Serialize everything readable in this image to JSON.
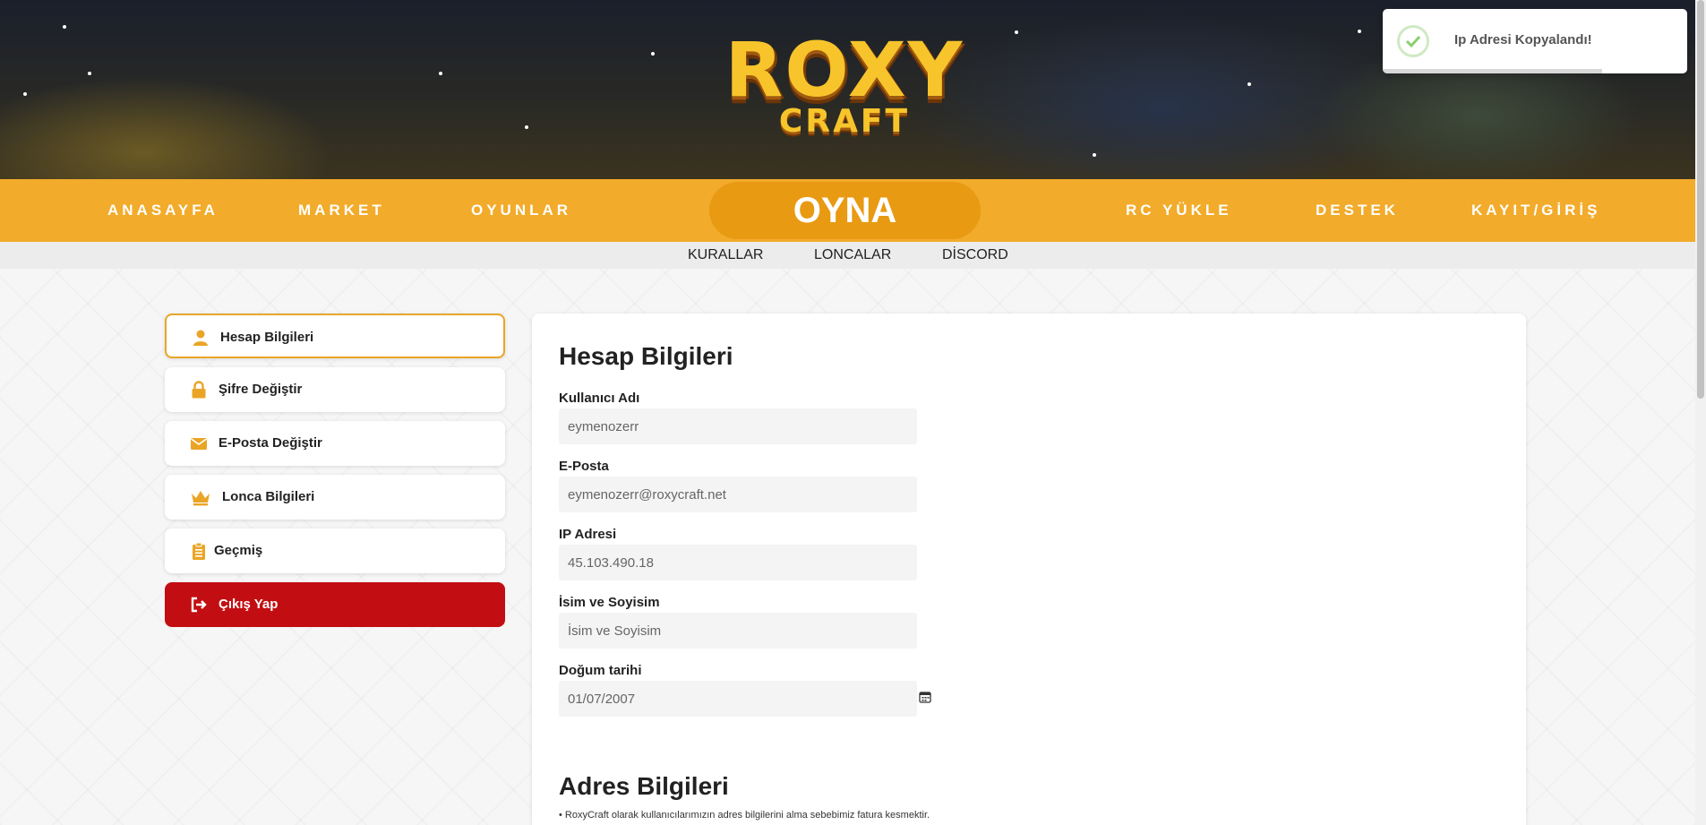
{
  "logo": {
    "line1": "ROXY",
    "line2": "CRAFT"
  },
  "nav": {
    "left": [
      "ANASAYFA",
      "MARKET",
      "OYUNLAR"
    ],
    "play": "OYNA",
    "right": [
      "RC YÜKLE",
      "DESTEK",
      "KAYIT/GİRİŞ"
    ]
  },
  "subnav": [
    "KURALLAR",
    "LONCALAR",
    "DİSCORD"
  ],
  "sidebar": {
    "items": [
      {
        "label": "Hesap Bilgileri",
        "icon": "user-icon"
      },
      {
        "label": "Şifre Değiştir",
        "icon": "lock-icon"
      },
      {
        "label": "E-Posta Değiştir",
        "icon": "envelope-icon"
      },
      {
        "label": "Lonca Bilgileri",
        "icon": "crown-icon"
      },
      {
        "label": "Geçmiş",
        "icon": "clipboard-icon"
      },
      {
        "label": "Çıkış Yap",
        "icon": "sign-out-icon"
      }
    ]
  },
  "account": {
    "title": "Hesap Bilgileri",
    "username_label": "Kullanıcı Adı",
    "username_value": "eymenozerr",
    "email_label": "E-Posta",
    "email_value": "eymenozerr@roxycraft.net",
    "ip_label": "IP Adresi",
    "ip_value": "45.103.490.18",
    "name_label": "İsim ve Soyisim",
    "name_placeholder": "İsim ve Soyisim",
    "birth_label": "Doğum tarihi",
    "birth_value": "01/07/2007"
  },
  "address": {
    "title": "Adres Bilgileri",
    "note": "RoxyCraft olarak kullanıcılarımızın adres bilgilerini alma sebebimiz fatura kesmektir."
  },
  "toast": {
    "message": "Ip Adresi Kopyalandı!",
    "progress": 0.72
  },
  "colors": {
    "accent": "#f2ab2a",
    "play": "#e89a12",
    "logout": "#c20e12",
    "icon": "#eaa526"
  }
}
